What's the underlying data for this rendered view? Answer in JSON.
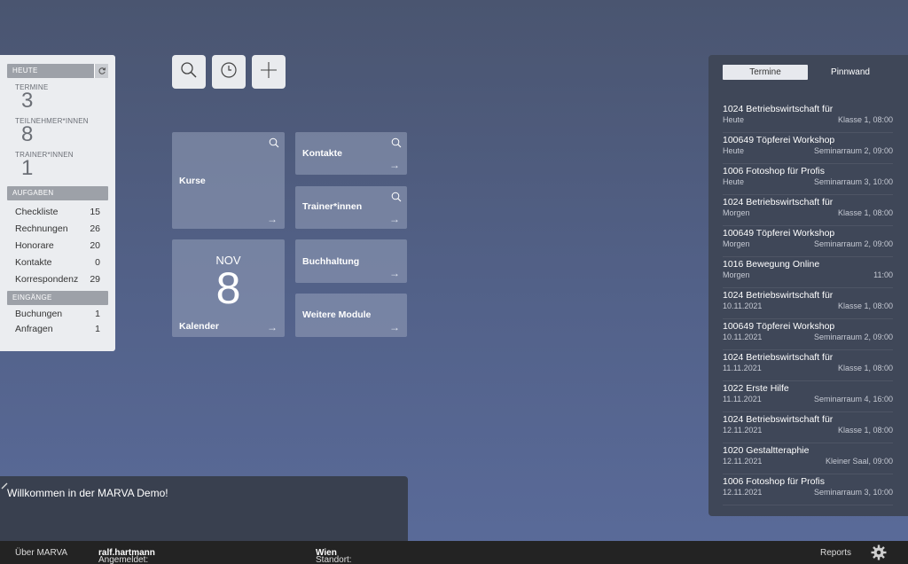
{
  "sidebar": {
    "heute_header": "HEUTE",
    "stats": [
      {
        "label": "TERMINE",
        "value": "3"
      },
      {
        "label": "TEILNEHMER*INNEN",
        "value": "8"
      },
      {
        "label": "TRAINER*INNEN",
        "value": "1"
      }
    ],
    "aufgaben_header": "AUFGABEN",
    "aufgaben": [
      {
        "label": "Checkliste",
        "count": "15"
      },
      {
        "label": "Rechnungen",
        "count": "26"
      },
      {
        "label": "Honorare",
        "count": "20"
      },
      {
        "label": "Kontakte",
        "count": "0"
      },
      {
        "label": "Korrespondenz",
        "count": "29"
      }
    ],
    "eingaenge_header": "EINGÄNGE",
    "eingaenge": [
      {
        "label": "Buchungen",
        "count": "1"
      },
      {
        "label": "Anfragen",
        "count": "1"
      }
    ]
  },
  "toolbar": {
    "icons": [
      "search-icon",
      "clock-icon",
      "plus-icon"
    ]
  },
  "tiles": {
    "kurse": "Kurse",
    "kontakte": "Kontakte",
    "trainer": "Trainer*innen",
    "kalender_month": "NOV",
    "kalender_day": "8",
    "kalender": "Kalender",
    "buchhaltung": "Buchhaltung",
    "weitere": "Weitere Module"
  },
  "welcome": {
    "text": "Willkommen in der MARVA Demo!"
  },
  "footer": {
    "about": "Über MARVA",
    "logged_in_label": "Angemeldet:",
    "user": "ralf.hartmann",
    "location_label": "Standort:",
    "location": "Wien",
    "reports": "Reports"
  },
  "right_panel": {
    "tab_active": "Termine",
    "tab_inactive": "Pinnwand",
    "events": [
      {
        "title": "1024 Betriebswirtschaft für",
        "day": "Heute",
        "info": "Klasse 1, 08:00"
      },
      {
        "title": "100649 Töpferei Workshop",
        "day": "Heute",
        "info": "Seminarraum 2, 09:00"
      },
      {
        "title": "1006 Fotoshop für Profis",
        "day": "Heute",
        "info": "Seminarraum 3, 10:00"
      },
      {
        "title": "1024 Betriebswirtschaft für",
        "day": "Morgen",
        "info": "Klasse 1, 08:00"
      },
      {
        "title": "100649 Töpferei Workshop",
        "day": "Morgen",
        "info": "Seminarraum 2, 09:00"
      },
      {
        "title": "1016 Bewegung Online",
        "day": "Morgen",
        "info": "11:00"
      },
      {
        "title": "1024 Betriebswirtschaft für",
        "day": "10.11.2021",
        "info": "Klasse 1, 08:00"
      },
      {
        "title": "100649 Töpferei Workshop",
        "day": "10.11.2021",
        "info": "Seminarraum 2, 09:00"
      },
      {
        "title": "1024 Betriebswirtschaft für",
        "day": "11.11.2021",
        "info": "Klasse 1, 08:00"
      },
      {
        "title": "1022 Erste Hilfe",
        "day": "11.11.2021",
        "info": "Seminarraum 4, 16:00"
      },
      {
        "title": "1024 Betriebswirtschaft für",
        "day": "12.11.2021",
        "info": "Klasse 1, 08:00"
      },
      {
        "title": "1020 Gestaltteraphie",
        "day": "12.11.2021",
        "info": "Kleiner Saal, 09:00"
      },
      {
        "title": "1006 Fotoshop für Profis",
        "day": "12.11.2021",
        "info": "Seminarraum 3, 10:00"
      }
    ]
  }
}
